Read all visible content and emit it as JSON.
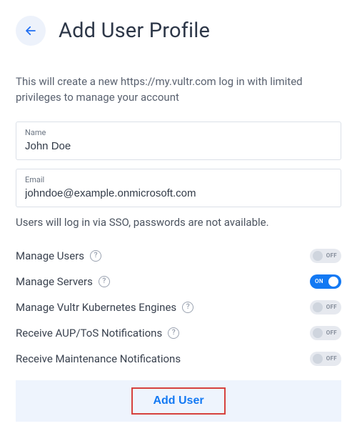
{
  "header": {
    "title": "Add User Profile"
  },
  "intro": "This will create a new https://my.vultr.com log in with limited privileges to manage your account",
  "fields": {
    "name": {
      "label": "Name",
      "value": "John Doe"
    },
    "email": {
      "label": "Email",
      "value": "johndoe@example.onmicrosoft.com"
    }
  },
  "sso_note": "Users will log in via SSO, passwords are not available.",
  "permissions": [
    {
      "label": "Manage Users",
      "help": true,
      "on": false
    },
    {
      "label": "Manage Servers",
      "help": true,
      "on": true
    },
    {
      "label": "Manage Vultr Kubernetes Engines",
      "help": true,
      "on": false
    },
    {
      "label": "Receive AUP/ToS Notifications",
      "help": true,
      "on": false
    },
    {
      "label": "Receive Maintenance Notifications",
      "help": false,
      "on": false
    }
  ],
  "toggle_labels": {
    "on": "ON",
    "off": "OFF"
  },
  "submit_label": "Add User"
}
